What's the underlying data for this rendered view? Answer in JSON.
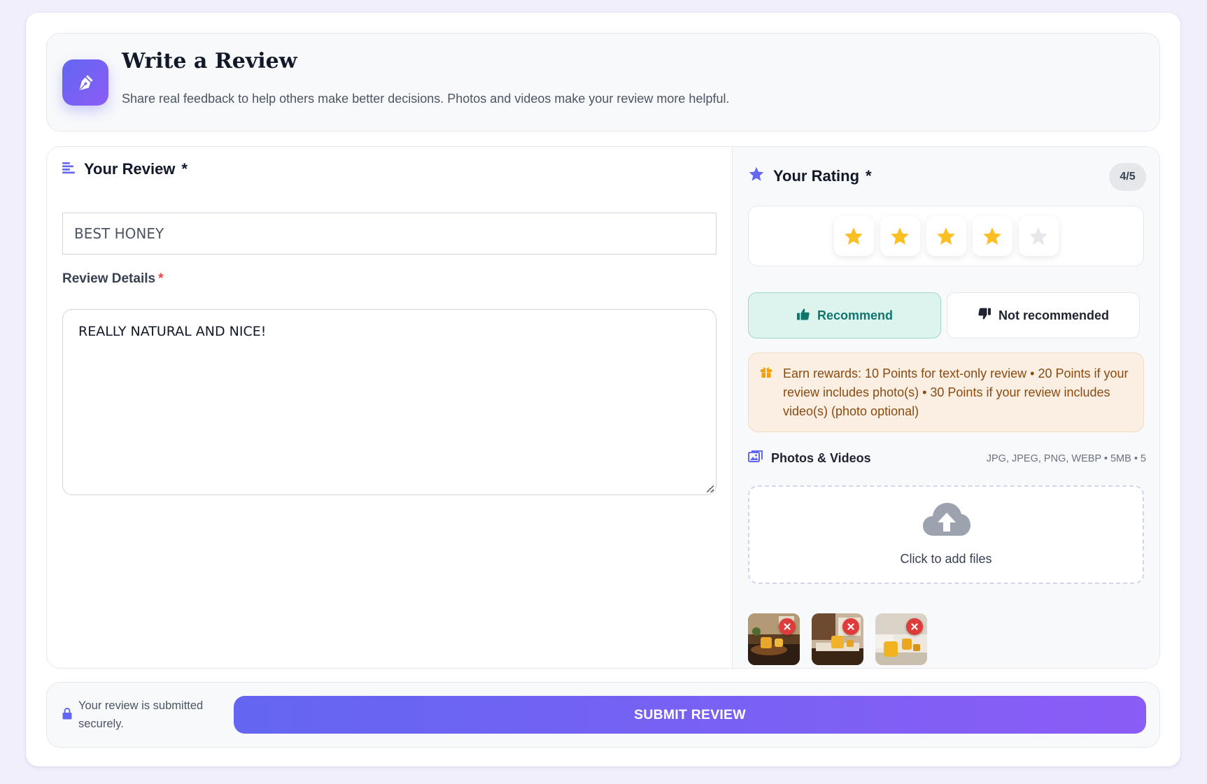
{
  "header": {
    "title": "Write a Review",
    "subtitle": "Share real feedback to help others make better decisions. Photos and videos make your review more helpful.",
    "icon": "pen-icon"
  },
  "review": {
    "section_title": "Your Review",
    "required_mark": "*",
    "title_value": "BEST HONEY",
    "details_label": "Review Details",
    "details_required": "*",
    "details_value": "REALLY NATURAL AND NICE!"
  },
  "rating": {
    "section_title": "Your Rating",
    "required_mark": "*",
    "badge": "4/5",
    "value": 4,
    "max": 5,
    "filled_color": "#fbbf24",
    "empty_color": "#e5e7eb"
  },
  "recommend": {
    "yes_label": "Recommend",
    "no_label": "Not recommended",
    "selected": "yes"
  },
  "rewards": {
    "text": "Earn rewards: 10 Points for text-only review • 20 Points if your review includes photo(s) • 30 Points if your review includes video(s) (photo optional)"
  },
  "media": {
    "title": "Photos & Videos",
    "formats": "JPG, JPEG, PNG, WEBP • 5MB • 5",
    "upload_label": "Click to add files",
    "thumbnails": [
      "honey-photo-1",
      "honey-photo-2",
      "honey-photo-3"
    ]
  },
  "footer": {
    "secure_text": "Your review is submitted securely.",
    "submit_label": "SUBMIT REVIEW"
  },
  "colors": {
    "accent": "#6366f1",
    "accent_end": "#8b5cf6",
    "recommend_bg": "#dcf3ee",
    "recommend_text": "#0f766e",
    "rewards_bg": "#fbefe3",
    "rewards_text": "#8a4a10"
  }
}
